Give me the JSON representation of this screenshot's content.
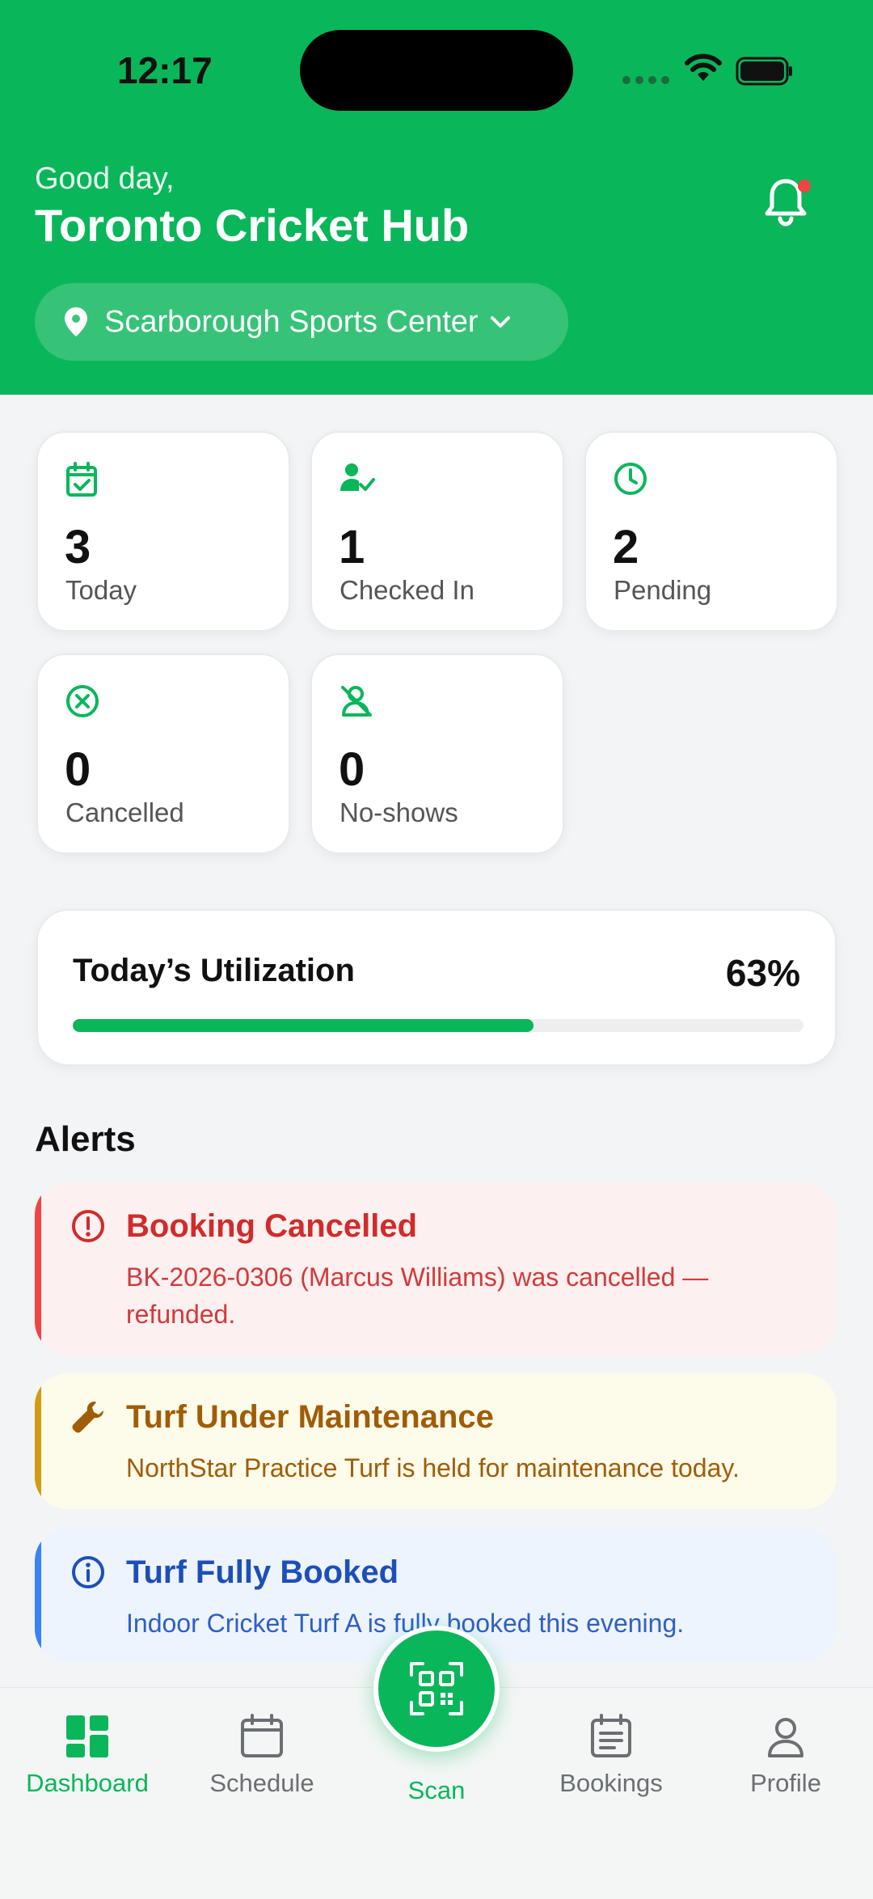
{
  "status_bar": {
    "time": "12:17"
  },
  "header": {
    "greeting": "Good day,",
    "title": "Toronto Cricket Hub",
    "location": "Scarborough Sports Center"
  },
  "stats": [
    {
      "value": "3",
      "label": "Today",
      "icon": "calendar-check-icon"
    },
    {
      "value": "1",
      "label": "Checked In",
      "icon": "user-check-icon"
    },
    {
      "value": "2",
      "label": "Pending",
      "icon": "clock-icon"
    },
    {
      "value": "0",
      "label": "Cancelled",
      "icon": "x-circle-icon"
    },
    {
      "value": "0",
      "label": "No-shows",
      "icon": "user-off-icon"
    }
  ],
  "utilization": {
    "title": "Today’s Utilization",
    "percent_label": "63%",
    "percent": 63
  },
  "alerts": {
    "heading": "Alerts",
    "items": [
      {
        "type": "error",
        "title": "Booking Cancelled",
        "body": "BK-2026-0306 (Marcus Williams) was cancelled — refunded."
      },
      {
        "type": "warning",
        "title": "Turf Under Maintenance",
        "body": "NorthStar Practice Turf is held for maintenance today."
      },
      {
        "type": "info",
        "title": "Turf Fully Booked",
        "body": "Indoor Cricket Turf A is fully booked this evening."
      }
    ]
  },
  "nav": {
    "dashboard": "Dashboard",
    "schedule": "Schedule",
    "scan": "Scan",
    "bookings": "Bookings",
    "profile": "Profile"
  },
  "colors": {
    "brand": "#0ab65a",
    "error": "#ef4444",
    "warning": "#d39a12",
    "info": "#3b82f6"
  }
}
